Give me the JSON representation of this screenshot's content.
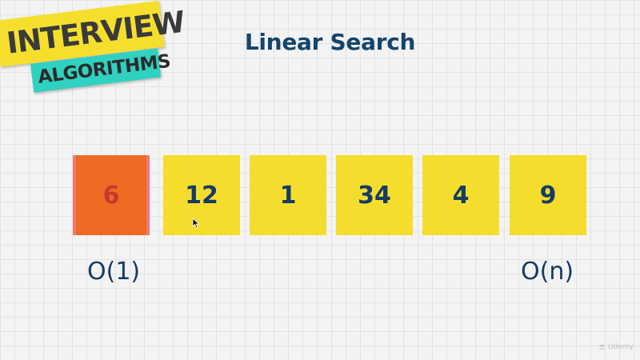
{
  "logo": {
    "line1": "INTERVIEW",
    "line2": "ALGORITHMS",
    "colors": {
      "band1": "#f6df2c",
      "band2": "#2fd1c0",
      "text": "#3a3a3a"
    }
  },
  "title": "Linear Search",
  "array": {
    "cells": [
      {
        "value": "6",
        "state": "active"
      },
      {
        "value": "12",
        "state": "normal"
      },
      {
        "value": "1",
        "state": "normal"
      },
      {
        "value": "34",
        "state": "normal"
      },
      {
        "value": "4",
        "state": "normal"
      },
      {
        "value": "9",
        "state": "normal"
      }
    ],
    "colors": {
      "normal_fill": "#f5dd2e",
      "active_fill": "#ef6a22",
      "active_edge": "#f07872",
      "text": "#153c63",
      "active_text": "#c43a2a"
    }
  },
  "complexity": {
    "best": "O(1)",
    "worst": "O(n)"
  },
  "cursor": {
    "icon": "mouse-pointer-icon"
  },
  "watermark": {
    "icon": "udemy-logo-icon",
    "text": "Udemy"
  }
}
